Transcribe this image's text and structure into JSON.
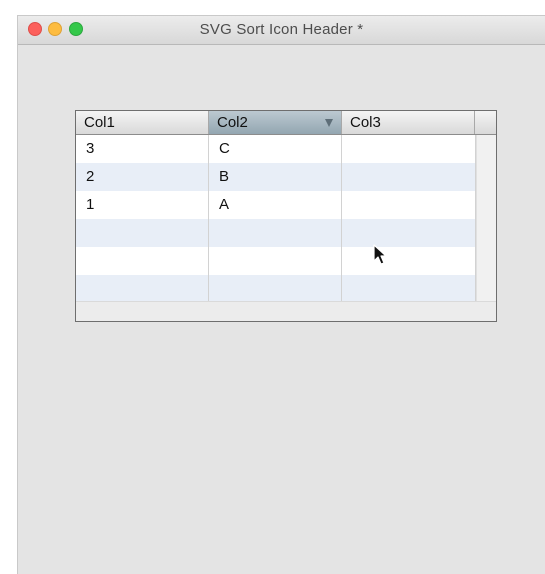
{
  "window": {
    "title": "SVG Sort Icon Header *"
  },
  "table": {
    "columns": [
      {
        "label": "Col1"
      },
      {
        "label": "Col2",
        "sorted": "descending"
      },
      {
        "label": "Col3"
      }
    ],
    "rows": [
      [
        "3",
        "C",
        ""
      ],
      [
        "2",
        "B",
        ""
      ],
      [
        "1",
        "A",
        ""
      ],
      [
        "",
        "",
        ""
      ],
      [
        "",
        "",
        ""
      ],
      [
        "",
        "",
        ""
      ]
    ]
  },
  "icons": {
    "sort": "triangle-down-icon",
    "cursor": "arrow-cursor-icon"
  },
  "colors": {
    "sorted_header": "#a9bac4",
    "alt_row": "#e8eef7",
    "close": "#fc605c",
    "minimize": "#fdbc40",
    "zoom": "#34c84a"
  }
}
